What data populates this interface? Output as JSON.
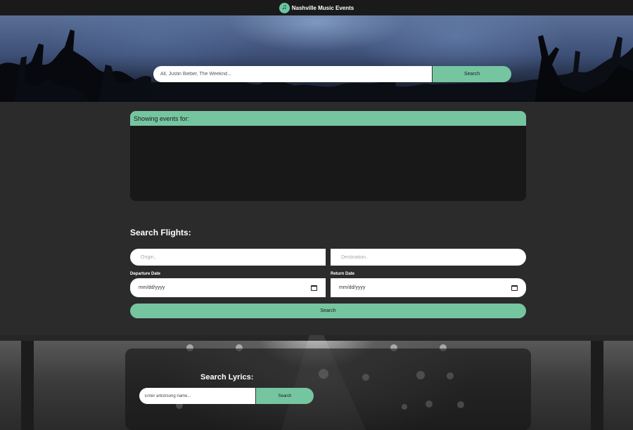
{
  "header": {
    "title": "Nashville Music Events",
    "logo_icon": "music-note-icon",
    "logo_glyph": "♫"
  },
  "hero": {
    "search_placeholder": "All, Justin Bieber, The Weeknd...",
    "search_button": "Search"
  },
  "events": {
    "heading": "Showing events for:"
  },
  "flights": {
    "title": "Search Flights:",
    "origin_placeholder": "Origin..",
    "destination_placeholder": "Destination..",
    "departure_label": "Departure Date",
    "return_label": "Return Date",
    "departure_value": "mm/dd/yyyy",
    "return_value": "mm/dd/yyyy",
    "search_button": "Search"
  },
  "lyrics": {
    "title": "Search Lyrics:",
    "search_placeholder": "Enter artist/song name...",
    "search_button": "Search"
  },
  "colors": {
    "accent": "#76c5a1",
    "background": "#2b2b2b",
    "topbar": "#1a1a1a",
    "panel": "#181818"
  }
}
